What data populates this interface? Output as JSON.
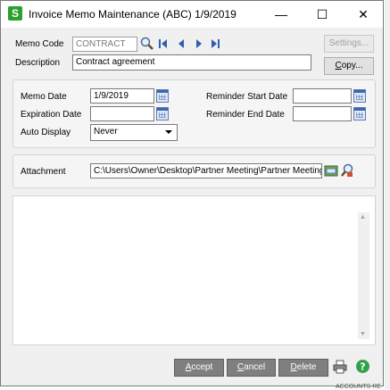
{
  "window": {
    "title": "Invoice Memo Maintenance (ABC) 1/9/2019",
    "app_icon_letter": "S",
    "minimize": "—",
    "maximize": "☐",
    "close": "✕"
  },
  "header": {
    "memo_code_label": "Memo Code",
    "memo_code_value": "CONTRACT",
    "description_label": "Description",
    "description_value": "Contract agreement",
    "settings_button": "Settings...",
    "copy_button": "Copy..."
  },
  "dates": {
    "memo_date_label": "Memo Date",
    "memo_date_value": "1/9/2019",
    "expiration_date_label": "Expiration Date",
    "expiration_date_value": "",
    "auto_display_label": "Auto Display",
    "auto_display_value": "Never",
    "reminder_start_label": "Reminder Start Date",
    "reminder_start_value": "",
    "reminder_end_label": "Reminder End Date",
    "reminder_end_value": ""
  },
  "attachment": {
    "label": "Attachment",
    "value": "C:\\Users\\Owner\\Desktop\\Partner Meeting\\Partner Meeting"
  },
  "memo_text": "",
  "footer": {
    "accept_button": "Accept",
    "cancel_button": "Cancel",
    "delete_button": "Delete"
  },
  "background_fragment": "ACCOUNTS RE"
}
